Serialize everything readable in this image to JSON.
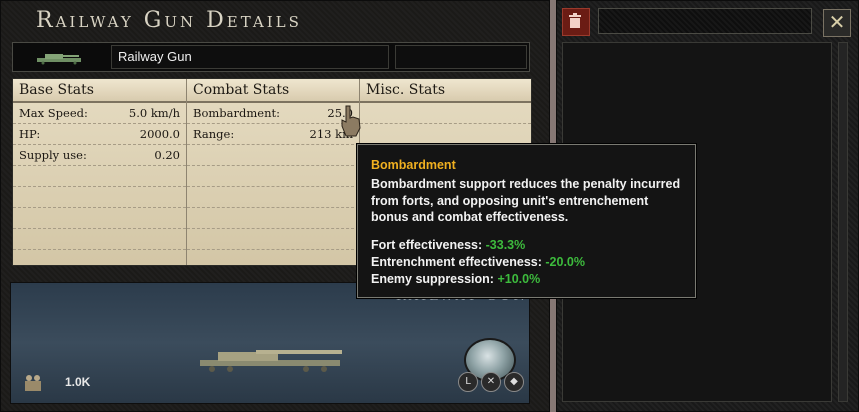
{
  "window": {
    "title": "Railway Gun Details"
  },
  "unit": {
    "name": "Railway Gun",
    "preview_label": "RAILWAY GUN",
    "manpower": "1.0K"
  },
  "tables": {
    "base": {
      "header": "Base Stats",
      "rows": [
        {
          "label": "Max Speed:",
          "value": "5.0 km/h"
        },
        {
          "label": "HP:",
          "value": "2000.0"
        },
        {
          "label": "Supply use:",
          "value": "0.20"
        }
      ]
    },
    "combat": {
      "header": "Combat Stats",
      "rows": [
        {
          "label": "Bombardment:",
          "value": "25.0"
        },
        {
          "label": "Range:",
          "value": "213 km"
        }
      ]
    },
    "misc": {
      "header": "Misc. Stats",
      "rows": []
    }
  },
  "tooltip": {
    "title": "Bombardment",
    "description": "Bombardment support reduces the penalty incurred from forts, and opposing unit's entrenchement bonus and combat effectiveness.",
    "lines": [
      {
        "label": "Fort effectiveness:",
        "value": "-33.3%"
      },
      {
        "label": "Entrenchment effectiveness:",
        "value": "-20.0%"
      },
      {
        "label": "Enemy suppression:",
        "value": "+10.0%"
      }
    ]
  },
  "icons": {
    "trash": "trash-icon",
    "close": "close-icon",
    "manpower": "manpower-icon",
    "unit": "railway-gun-icon"
  },
  "colors": {
    "accent": "#f0b020",
    "modifier": "#3dbb3d",
    "trash_bg": "#6b1c14"
  }
}
